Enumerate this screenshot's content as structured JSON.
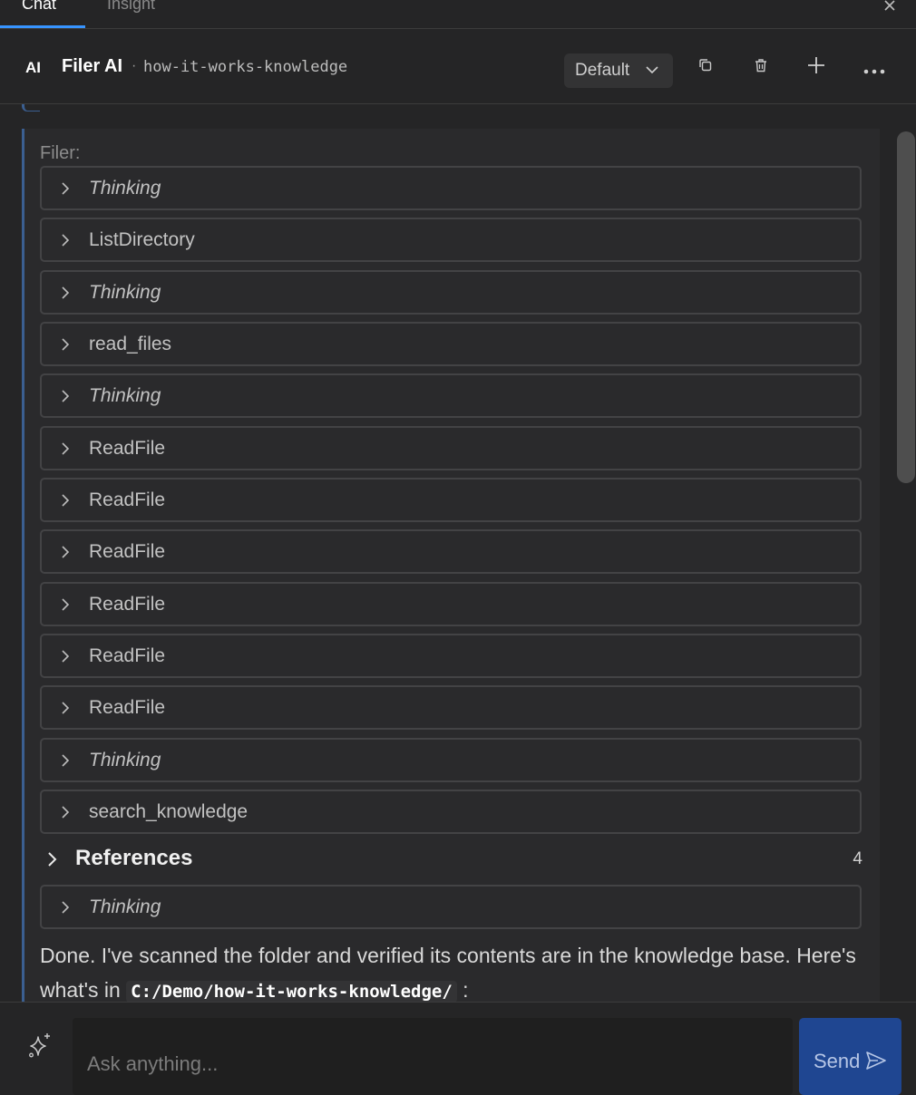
{
  "tabs": [
    {
      "label": "Chat",
      "active": true
    },
    {
      "label": "Insight",
      "active": false
    }
  ],
  "header": {
    "badge": "AI",
    "title": "Filer AI",
    "separator": "·",
    "workspace": "how-it-works-knowledge",
    "mode": "Default"
  },
  "message": {
    "label": "Filer:",
    "steps": [
      {
        "label": "Thinking",
        "italic": true
      },
      {
        "label": "ListDirectory",
        "italic": false
      },
      {
        "label": "Thinking",
        "italic": true
      },
      {
        "label": "read_files",
        "italic": false
      },
      {
        "label": "Thinking",
        "italic": true
      },
      {
        "label": "ReadFile",
        "italic": false
      },
      {
        "label": "ReadFile",
        "italic": false
      },
      {
        "label": "ReadFile",
        "italic": false
      },
      {
        "label": "ReadFile",
        "italic": false
      },
      {
        "label": "ReadFile",
        "italic": false
      },
      {
        "label": "ReadFile",
        "italic": false
      },
      {
        "label": "Thinking",
        "italic": true
      },
      {
        "label": "search_knowledge",
        "italic": false
      }
    ],
    "references": {
      "label": "References",
      "count": "4"
    },
    "final_step": {
      "label": "Thinking",
      "italic": true
    },
    "answer": {
      "text": "Done. I've scanned the folder and verified its contents are in the knowledge base. Here's what's in",
      "path": "C:/Demo/how-it-works-knowledge/",
      "suffix": ":"
    }
  },
  "input": {
    "placeholder": "Ask anything...",
    "send_label": "Send"
  },
  "colors": {
    "accent_tab": "#3794ff",
    "message_border": "#3b5f91",
    "send_button": "#1f4691"
  }
}
